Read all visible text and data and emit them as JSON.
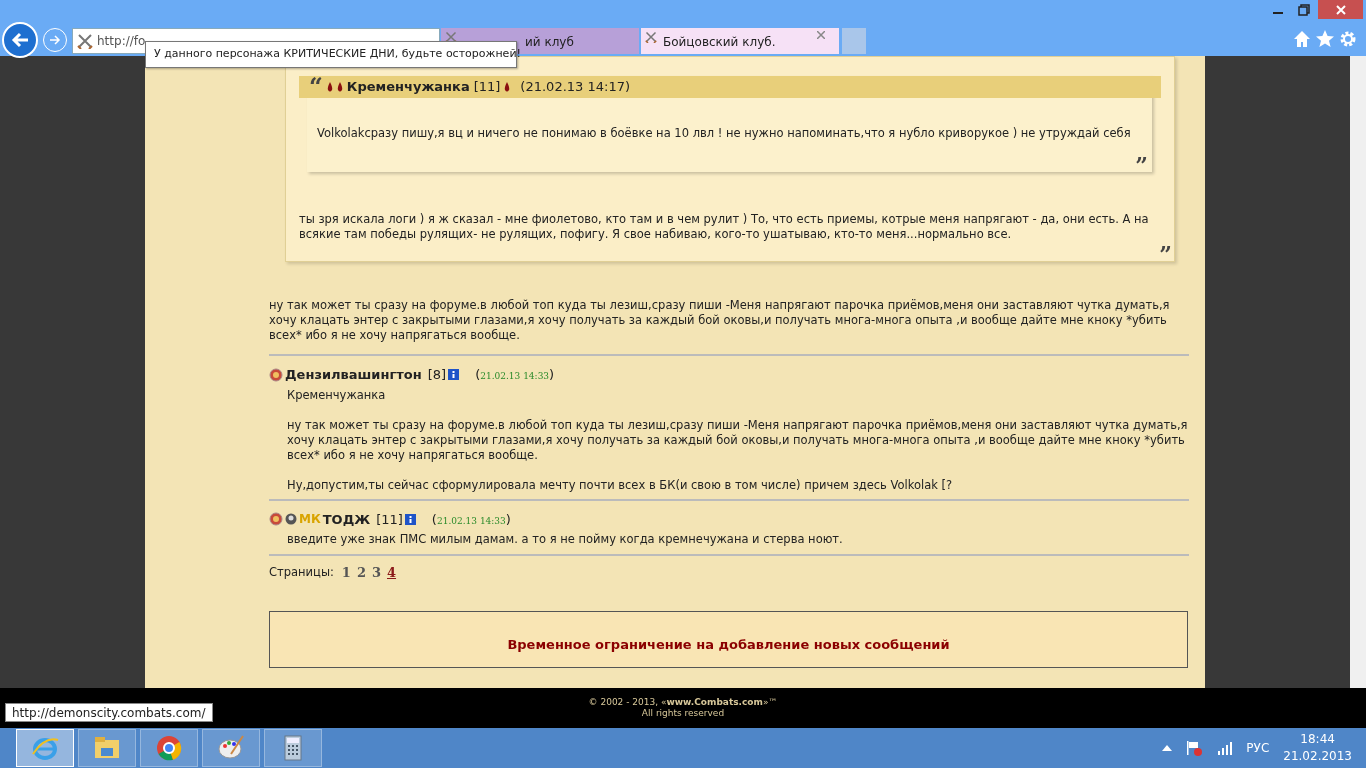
{
  "browser": {
    "address": "http://fo",
    "tabs": [
      {
        "title": "ий клуб",
        "selected": false
      },
      {
        "title": "Бойцовский клуб.",
        "selected": true
      }
    ],
    "tooltip": "У данного персонажа КРИТИЧЕСКИЕ ДНИ, будьте осторожней!",
    "status_url": "http://demonscity.combats.com/"
  },
  "quote": {
    "open_mark": "“",
    "close_mark": "”",
    "inner": {
      "author": "Кременчужанка",
      "level": "[11]",
      "date": "(21.02.13 14:17)",
      "text": "Volkolakсразу пишу,я вц и ничего не понимаю в боёвке на 10 лвл ! не нужно напоминать,что я нубло криворукое ) не утруждай себя"
    },
    "text": "ты зря искала логи ) я ж сказал - мне фиолетово, кто там и в чем рулит ) То, что есть приемы, котрые меня напрягают - да, они есть. А на всякие там победы рулящих- не рулящих, пофигу. Я свое набиваю, кого-то ушатываю, кто-то меня...нормально все."
  },
  "post_text": "ну так может ты сразу на форуме.в любой топ куда ты лезиш,сразу пиши -Меня напрягают парочка приёмов,меня они заставляют чутка думать,я хочу клацать энтер с закрытыми глазами,я хочу получать за каждый бой оковы,и получать многа-многа опыта ,и вообще дайте мне кноку *убить всех* ибо я не хочу напрягаться вообще.",
  "posts": [
    {
      "author": "Дензилвашингтон",
      "level": "[8]",
      "date_prefix": "(",
      "date": "21.02.13 14:33",
      "date_suffix": ")",
      "paragraphs": [
        "Кременчужанка",
        "ну так может ты сразу на форуме.в любой топ куда ты лезиш,сразу пиши -Меня напрягают парочка приёмов,меня они заставляют чутка думать,я хочу клацать энтер с закрытыми глазами,я хочу получать за каждый бой оковы,и получать многа-многа опыта ,и вообще дайте мне кноку *убить всех* ибо я не хочу напрягаться вообще.",
        "Ну,допустим,ты сейчас сформулировала мечту почти всех в БК(и свою в том числе) причем здесь Volkolak [?"
      ]
    },
    {
      "author": "ТОДЖ",
      "level": "[11]",
      "date_prefix": "(",
      "date": "21.02.13 14:33",
      "date_suffix": ")",
      "badge": "МК",
      "paragraphs": [
        "введите уже знак ПМС милым дамам. а то я не пойму когда кремнечужана и стерва ноют."
      ]
    }
  ],
  "pages": {
    "label": "Страницы:",
    "items": [
      {
        "label": "1",
        "selected": false
      },
      {
        "label": "2",
        "selected": false
      },
      {
        "label": "3",
        "selected": false
      },
      {
        "label": "4",
        "selected": true
      }
    ]
  },
  "notice": "Временное ограничение на добавление новых сообщений",
  "footer": {
    "copyright_prefix": "© 2002 - 2013, «",
    "site": "www.Combats.com",
    "copyright_suffix": "»™",
    "rights": "All rights reserved"
  },
  "taskbar": {
    "apps": [
      {
        "kind": "browser",
        "selected": true
      },
      {
        "kind": "folder",
        "selected": false
      },
      {
        "kind": "chrome",
        "selected": false
      },
      {
        "kind": "paint",
        "selected": false
      },
      {
        "kind": "calculator",
        "selected": false
      }
    ],
    "language": "РУС",
    "time": "18:44",
    "date": "21.02.2013"
  }
}
